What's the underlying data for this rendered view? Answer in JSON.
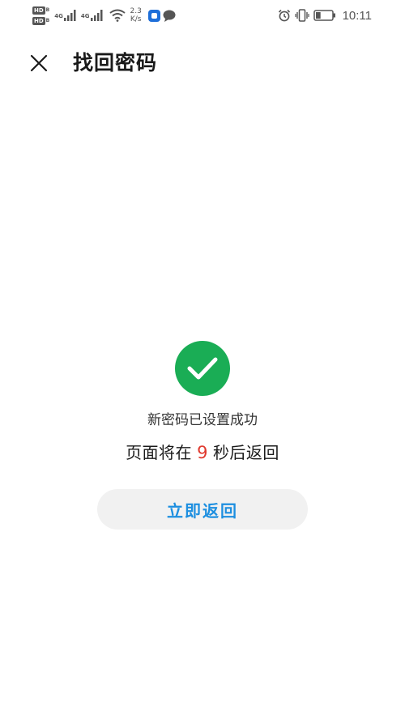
{
  "status_bar": {
    "hd_badges": [
      "HD",
      "HD"
    ],
    "network_labels": [
      "4G",
      "4G"
    ],
    "speed_value": "2.3",
    "speed_unit": "K/s",
    "time": "10:11",
    "battery_level": 0.3,
    "icons": [
      "signal-bars-icon",
      "wifi-icon",
      "app-notification-icon",
      "chat-bubble-icon",
      "alarm-icon",
      "vibrate-icon",
      "battery-icon"
    ]
  },
  "header": {
    "title": "找回密码",
    "close_icon": "close-icon"
  },
  "result": {
    "status_icon": "checkmark-icon",
    "status_color": "#1aad55",
    "message": "新密码已设置成功",
    "countdown_prefix": "页面将在",
    "countdown_seconds": "9",
    "countdown_suffix": "秒后返回",
    "countdown_color": "#e03a2f"
  },
  "actions": {
    "return_now_label": "立即返回",
    "accent_color": "#1d8fe0"
  }
}
